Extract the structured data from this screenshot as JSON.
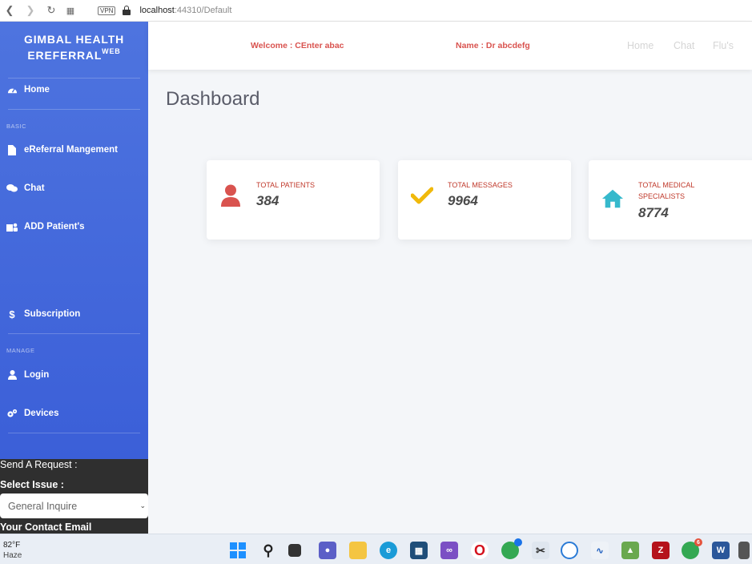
{
  "browser": {
    "url_host": "localhost",
    "url_rest": ":44310/Default",
    "vpn_label": "VPN",
    "icons": [
      "back-icon",
      "forward-icon",
      "reload-icon",
      "tabs-grid-icon",
      "lock-icon"
    ]
  },
  "sidebar": {
    "brand_line1": "GIMBAL HEALTH",
    "brand_line2": "EREFERRAL",
    "brand_sup": "WEB",
    "items": [
      {
        "label": "Home",
        "icon": "dashboard-icon"
      },
      {
        "label": "eReferral Mangement",
        "icon": "file-icon"
      },
      {
        "label": "Chat",
        "icon": "comments-icon"
      },
      {
        "label": "ADD Patient's",
        "icon": "hospital-user-icon"
      },
      {
        "label": "Subscription",
        "icon": "dollar-icon"
      },
      {
        "label": "Login",
        "icon": "user-icon"
      },
      {
        "label": "Devices",
        "icon": "cogs-icon"
      }
    ],
    "sections": {
      "basic": "BASIC",
      "manage": "MANAGE"
    },
    "form": {
      "title": "Send A Request :",
      "issue_label": "Select Issue :",
      "issue_value": "General Inquire",
      "email_label": "Your Contact Email"
    }
  },
  "topbar": {
    "welcome": "Welcome : CEnter abac",
    "name": "Name : Dr abcdefg",
    "links": [
      "Home",
      "Chat",
      "Flu's"
    ]
  },
  "main": {
    "title": "Dashboard",
    "cards": [
      {
        "label": "TOTAL PATIENTS",
        "value": "384",
        "icon": "user-icon",
        "color": "#d9534f"
      },
      {
        "label": "TOTAL MESSAGES",
        "value": "9964",
        "icon": "check-icon",
        "color": "#f0b90b"
      },
      {
        "label": "TOTAL MEDICAL SPECIALISTS",
        "value": "8774",
        "icon": "home-icon",
        "color": "#36b9cc"
      }
    ]
  },
  "taskbar": {
    "temp": "82°F",
    "condition": "Haze",
    "badges": [
      "6",
      "6"
    ]
  },
  "colors": {
    "sidebar": "#4e74df",
    "accent_red": "#d9534f",
    "page_bg": "#f4f6f9"
  }
}
